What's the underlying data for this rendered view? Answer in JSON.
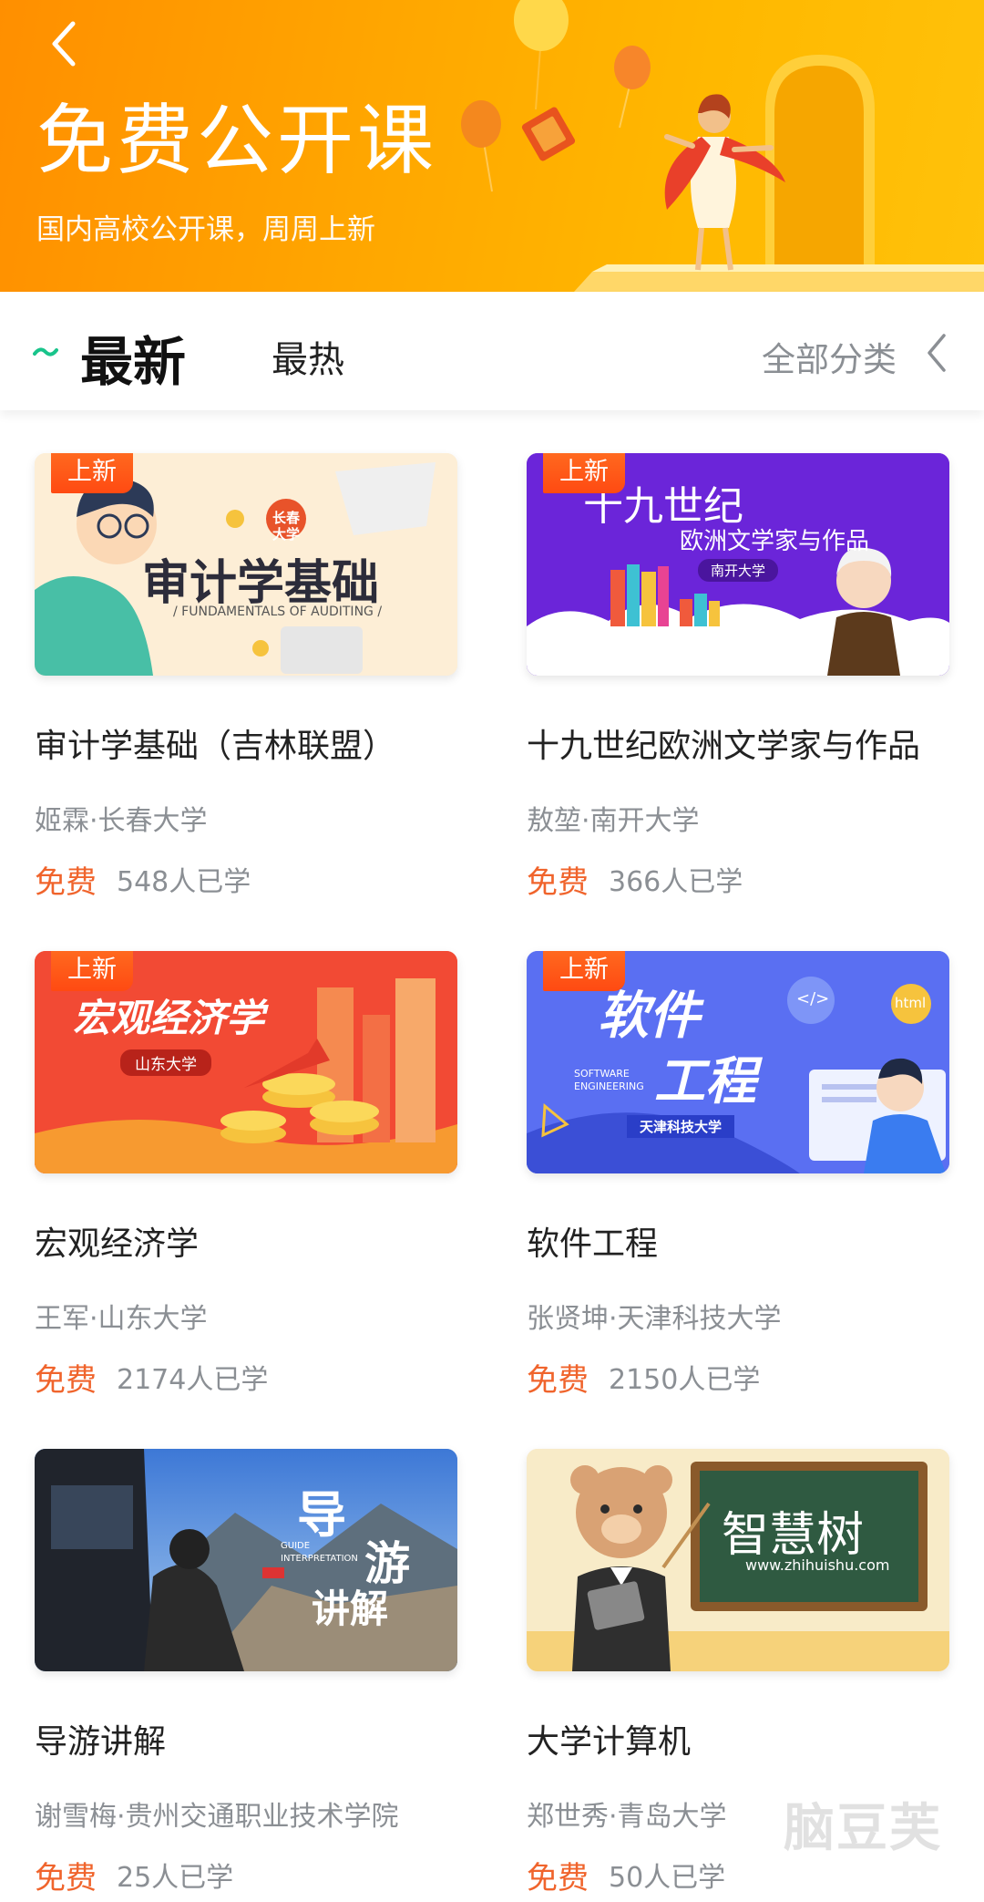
{
  "header": {
    "title": "免费公开课",
    "subtitle": "国内高校公开课，周周上新"
  },
  "tabs": {
    "latest": "最新",
    "hot": "最热",
    "all_categories": "全部分类"
  },
  "colors": {
    "brand_orange": "#ffa600",
    "accent_green": "#19c48b",
    "price_orange": "#f0642c",
    "badge_red": "#ff5317"
  },
  "courses": [
    {
      "badge": "上新",
      "title": "审计学基础（吉林联盟）",
      "teacher": "姬霖·长春大学",
      "price": "免费",
      "learners": "548人已学",
      "thumb": {
        "main": "审计学基础",
        "en": "/ FUNDAMENTALS OF AUDITING /",
        "tag": "长春大学"
      }
    },
    {
      "badge": "上新",
      "title": "十九世纪欧洲文学家与作品",
      "teacher": "敖堃·南开大学",
      "price": "免费",
      "learners": "366人已学",
      "thumb": {
        "main": "十九世纪",
        "line2": "欧洲文学家与作品",
        "tag": "南开大学"
      }
    },
    {
      "badge": "上新",
      "title": "宏观经济学",
      "teacher": "王军·山东大学",
      "price": "免费",
      "learners": "2174人已学",
      "thumb": {
        "main": "宏观经济学",
        "tag": "山东大学"
      }
    },
    {
      "badge": "上新",
      "title": "软件工程",
      "teacher": "张贤坤·天津科技大学",
      "price": "免费",
      "learners": "2150人已学",
      "thumb": {
        "main": "软件",
        "line2": "工程",
        "en": "SOFTWARE ENGINEERING",
        "tag": "天津科技大学",
        "code": "</>",
        "html": "html"
      }
    },
    {
      "badge": "",
      "title": "导游讲解",
      "teacher": "谢雪梅·贵州交通职业技术学院",
      "price": "免费",
      "learners": "25人已学",
      "thumb": {
        "main": "导",
        "line2": "游",
        "line3": "讲解",
        "en": "GUIDE INTERPRETATION"
      }
    },
    {
      "badge": "",
      "title": "大学计算机",
      "teacher": "郑世秀·青岛大学",
      "price": "免费",
      "learners": "50人已学",
      "thumb": {
        "main": "智慧树",
        "en": "www.zhihuishu.com"
      }
    }
  ],
  "watermark": "脑豆芙"
}
